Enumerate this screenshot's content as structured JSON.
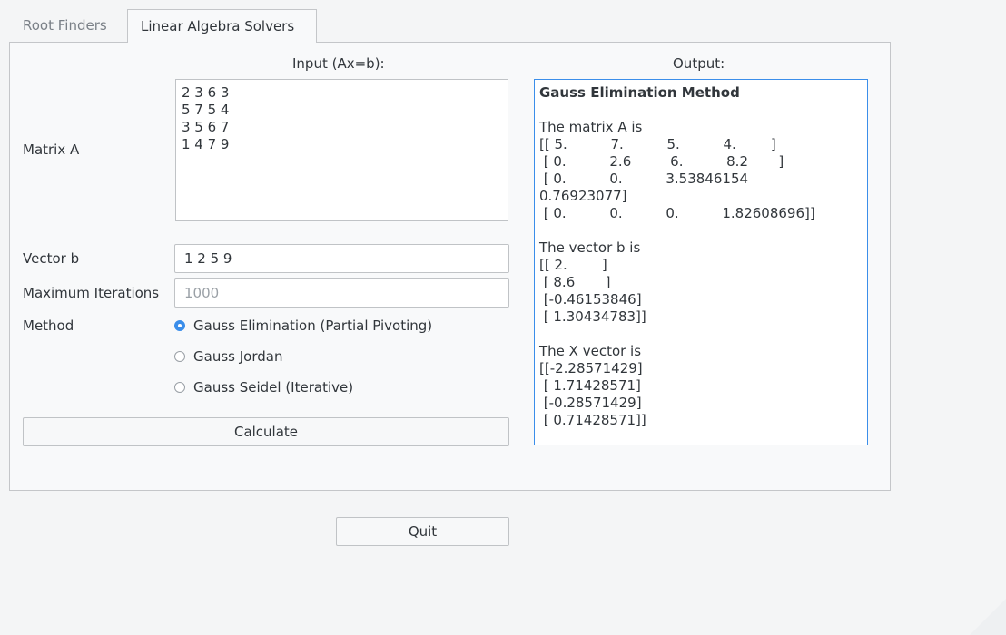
{
  "tabs": [
    {
      "label": "Root Finders",
      "active": false
    },
    {
      "label": "Linear Algebra Solvers",
      "active": true
    }
  ],
  "input_header": "Input (Ax=b):",
  "output_header": "Output:",
  "matrix": {
    "label": "Matrix A",
    "value": "2 3 6 3\n5 7 5 4\n3 5 6 7\n1 4 7 9"
  },
  "vector": {
    "label": "Vector b",
    "value": "1 2 5 9"
  },
  "iterations": {
    "label": "Maximum Iterations",
    "placeholder": "1000"
  },
  "method": {
    "label": "Method",
    "options": [
      {
        "label": "Gauss Elimination (Partial Pivoting)",
        "selected": true
      },
      {
        "label": "Gauss Jordan",
        "selected": false
      },
      {
        "label": "Gauss Seidel (Iterative)",
        "selected": false
      }
    ]
  },
  "calculate_label": "Calculate",
  "quit_label": "Quit",
  "output": {
    "title": "Gauss Elimination Method",
    "body": "\nThe matrix A is\n[[ 5.          7.          5.          4.        ]\n [ 0.          2.6         6.          8.2       ]\n [ 0.          0.          3.53846154\n0.76923077]\n [ 0.          0.          0.          1.82608696]]\n\nThe vector b is\n[[ 2.        ]\n [ 8.6       ]\n [-0.46153846]\n [ 1.30434783]]\n\nThe X vector is\n[[-2.28571429]\n [ 1.71428571]\n [-0.28571429]\n [ 0.71428571]]"
  },
  "colors": {
    "accent": "#3b8eea",
    "background": "#f4f5f6",
    "text": "#31363b"
  }
}
